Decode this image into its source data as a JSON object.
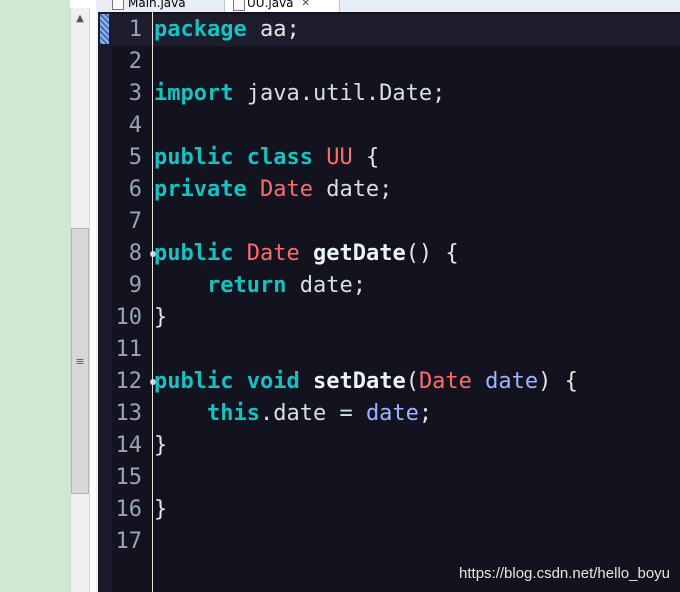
{
  "tabs": [
    {
      "label": "Main.java",
      "active": false
    },
    {
      "label": "UU.java",
      "active": true,
      "close": "✕"
    }
  ],
  "scrollbar": {
    "up": "▲",
    "grip": "≡"
  },
  "editor": {
    "line_numbers": [
      "1",
      "2",
      "3",
      "4",
      "5",
      "6",
      "7",
      "8",
      "9",
      "10",
      "11",
      "12",
      "13",
      "14",
      "15",
      "16",
      "17"
    ],
    "lines": [
      [
        {
          "t": "package",
          "c": "kw"
        },
        {
          "t": " aa;",
          "c": "pc"
        }
      ],
      [],
      [
        {
          "t": "import",
          "c": "kw"
        },
        {
          "t": " java.util.Date;",
          "c": "id"
        }
      ],
      [],
      [
        {
          "t": "public",
          "c": "kw"
        },
        {
          "t": " ",
          "c": "pc"
        },
        {
          "t": "class",
          "c": "kw"
        },
        {
          "t": " ",
          "c": "pc"
        },
        {
          "t": "UU",
          "c": "ty"
        },
        {
          "t": " {",
          "c": "pc"
        }
      ],
      [
        {
          "t": "private",
          "c": "kw"
        },
        {
          "t": " ",
          "c": "pc"
        },
        {
          "t": "Date",
          "c": "ty"
        },
        {
          "t": " date;",
          "c": "id"
        }
      ],
      [],
      [
        {
          "t": "public",
          "c": "kw"
        },
        {
          "t": " ",
          "c": "pc"
        },
        {
          "t": "Date",
          "c": "ty"
        },
        {
          "t": " ",
          "c": "pc"
        },
        {
          "t": "getDate",
          "c": "fn"
        },
        {
          "t": "() {",
          "c": "pc"
        }
      ],
      [
        {
          "t": "    ",
          "c": "pc"
        },
        {
          "t": "return",
          "c": "kw"
        },
        {
          "t": " date;",
          "c": "id"
        }
      ],
      [
        {
          "t": "}",
          "c": "pc"
        }
      ],
      [],
      [
        {
          "t": "public",
          "c": "kw"
        },
        {
          "t": " ",
          "c": "pc"
        },
        {
          "t": "void",
          "c": "kw"
        },
        {
          "t": " ",
          "c": "pc"
        },
        {
          "t": "setDate",
          "c": "fn"
        },
        {
          "t": "(",
          "c": "pc"
        },
        {
          "t": "Date",
          "c": "ty"
        },
        {
          "t": " ",
          "c": "pc"
        },
        {
          "t": "date",
          "c": "pa"
        },
        {
          "t": ") {",
          "c": "pc"
        }
      ],
      [
        {
          "t": "    ",
          "c": "pc"
        },
        {
          "t": "this",
          "c": "kw"
        },
        {
          "t": ".date = ",
          "c": "id"
        },
        {
          "t": "date",
          "c": "pa"
        },
        {
          "t": ";",
          "c": "pc"
        }
      ],
      [
        {
          "t": "}",
          "c": "pc"
        }
      ],
      [],
      [
        {
          "t": "}",
          "c": "pc"
        }
      ],
      []
    ],
    "fold_lines": [
      "8",
      "12"
    ]
  },
  "watermark": "https://blog.csdn.net/hello_boyu",
  "colors": {
    "keyword": "#16c1c1",
    "type": "#ff6b6b",
    "param": "#9db4ff",
    "background": "#131320"
  }
}
